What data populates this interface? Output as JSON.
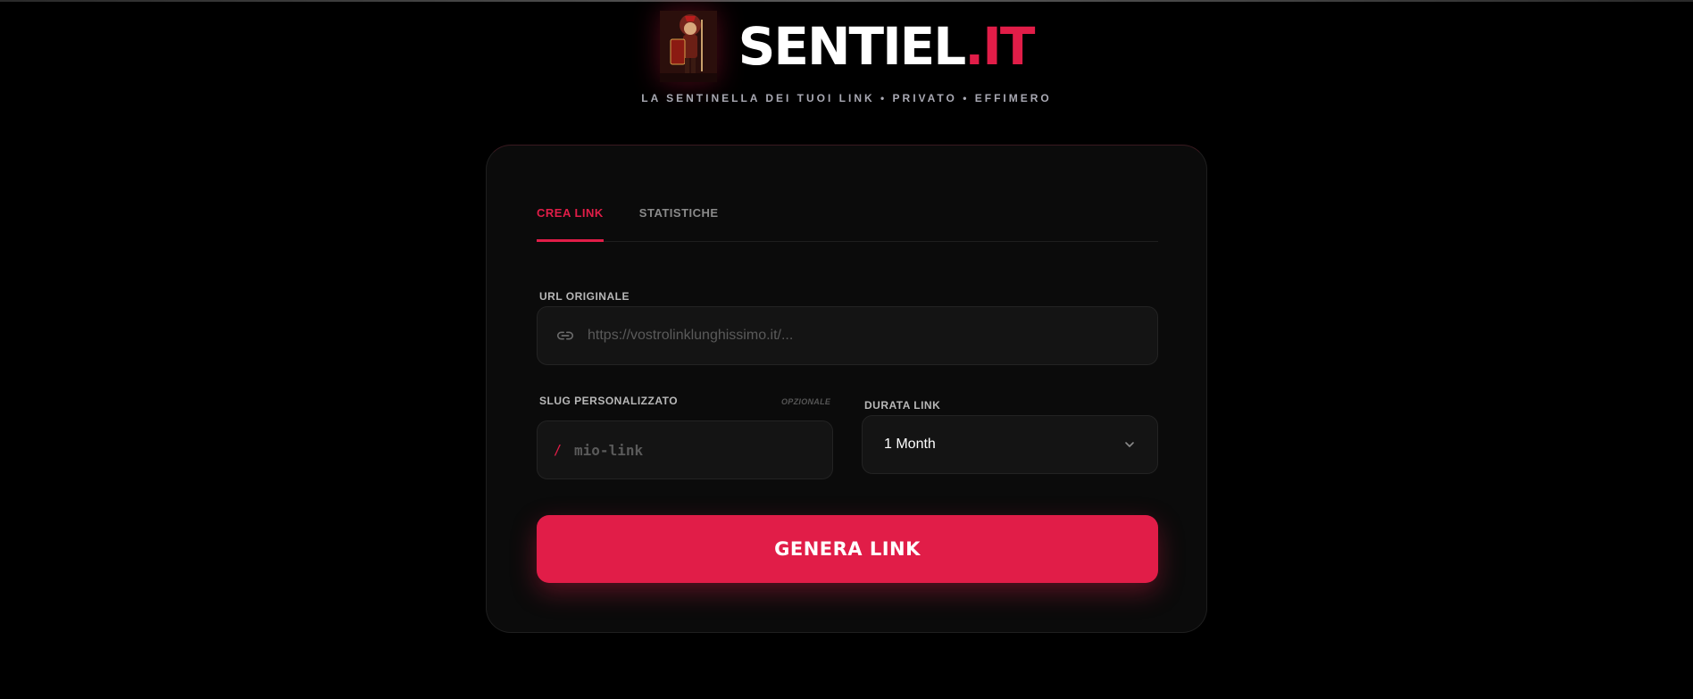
{
  "brand": {
    "name_main": "SENTIEL",
    "name_accent": ".IT",
    "tagline": "LA SENTINELLA DEI TUOI LINK • PRIVATO • EFFIMERO"
  },
  "tabs": [
    {
      "label": "CREA LINK",
      "active": true
    },
    {
      "label": "STATISTICHE",
      "active": false
    }
  ],
  "form": {
    "url": {
      "label": "URL ORIGINALE",
      "placeholder": "https://vostrolinklunghissimo.it/...",
      "icon": "link-icon"
    },
    "slug": {
      "label": "SLUG PERSONALIZZATO",
      "optional_tag": "OPZIONALE",
      "prefix": "/",
      "placeholder": "mio-link"
    },
    "duration": {
      "label": "DURATA LINK",
      "selected": "1 Month",
      "icon": "chevron-down-icon"
    },
    "submit_label": "GENERA LINK"
  },
  "colors": {
    "accent": "#e11d48",
    "background": "#000000",
    "card": "#0b0b0b"
  }
}
